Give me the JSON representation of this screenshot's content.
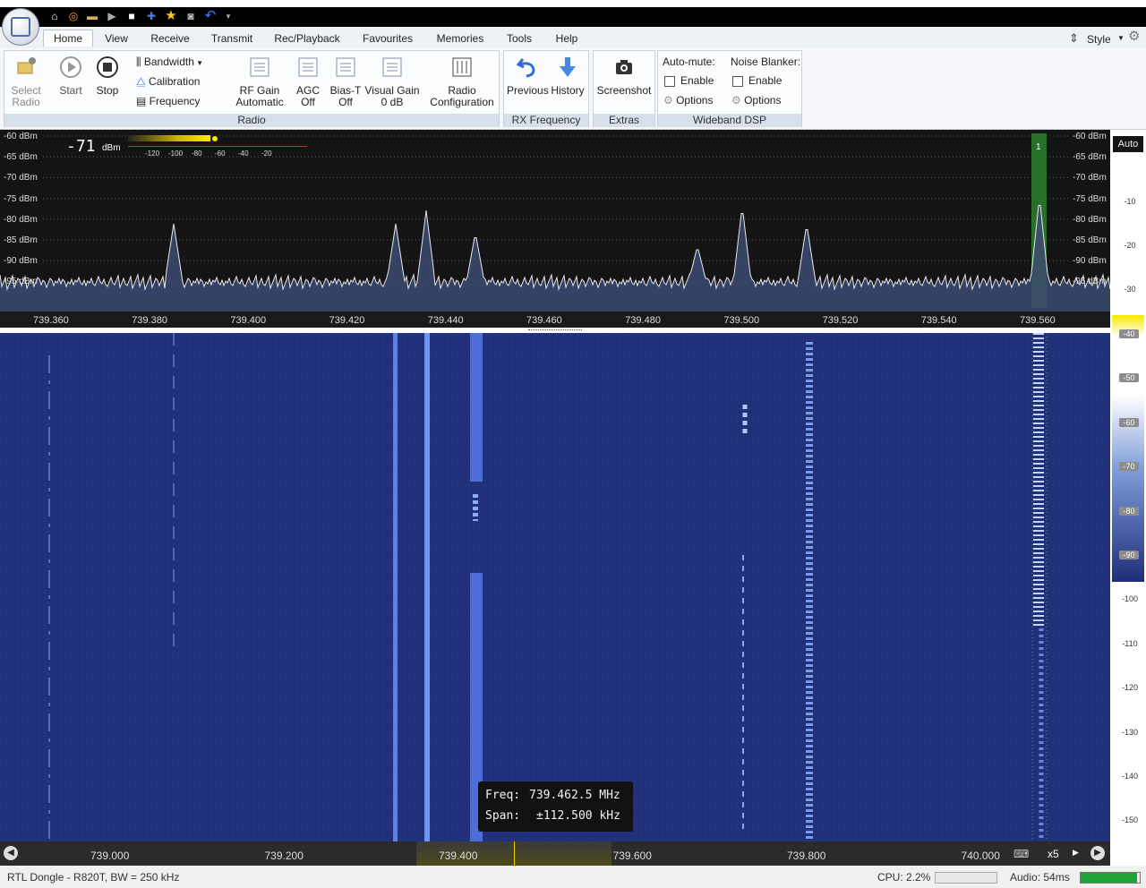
{
  "toolbar": {
    "style_label": "Style"
  },
  "tabs": [
    "Home",
    "View",
    "Receive",
    "Transmit",
    "Rec/Playback",
    "Favourites",
    "Memories",
    "Tools",
    "Help"
  ],
  "ribbon": {
    "select_radio": "Select\nRadio",
    "start": "Start",
    "stop": "Stop",
    "bandwidth": "Bandwidth",
    "calibration": "Calibration",
    "frequency": "Frequency",
    "rf_gain": "RF Gain",
    "rf_gain_val": "Automatic",
    "agc": "AGC",
    "agc_val": "Off",
    "biast": "Bias-T",
    "biast_val": "Off",
    "visual_gain": "Visual Gain",
    "visual_gain_val": "0 dB",
    "radio_config": "Radio\nConfiguration",
    "previous": "Previous",
    "history": "History",
    "screenshot": "Screenshot",
    "automute": "Auto-mute:",
    "noise_blanker": "Noise Blanker:",
    "enable": "Enable",
    "options": "Options",
    "group_radio": "Radio",
    "group_rx": "RX Frequency",
    "group_extras": "Extras",
    "group_wdsp": "Wideband DSP"
  },
  "spectrum": {
    "signal_value": "-71",
    "signal_unit": "dBm",
    "meter_ticks": [
      "-120",
      "-100",
      "-80",
      "-60",
      "-40",
      "-20"
    ],
    "left_db": [
      "-60 dBm",
      "-65 dBm",
      "-70 dBm",
      "-75 dBm",
      "-80 dBm",
      "-85 dBm",
      "-90 dBm",
      "-95 dBm"
    ],
    "right_db": [
      "-60 dBm",
      "-65 dBm",
      "-70 dBm",
      "-75 dBm",
      "-80 dBm",
      "-85 dBm",
      "-90 dBm",
      "-95 dBm"
    ],
    "right_scale_top": [
      "-10",
      "-20",
      "-30"
    ],
    "freq_ticks": [
      "739.360",
      "739.380",
      "739.400",
      "739.420",
      "739.440",
      "739.460",
      "739.480",
      "739.500",
      "739.520",
      "739.540",
      "739.560"
    ],
    "marker_label": "1"
  },
  "auto_label": "Auto",
  "waterfall_scale": [
    "-40",
    "-50",
    "-60",
    "-70",
    "-80",
    "-90",
    "-100",
    "-110",
    "-120",
    "-130",
    "-140",
    "-150"
  ],
  "tooltip": {
    "freq_label": "Freq:",
    "freq_value": "739.462.5 MHz",
    "span_label": "Span:",
    "span_value": "±112.500 kHz"
  },
  "overview": {
    "ticks": [
      "739.000",
      "739.200",
      "739.400",
      "739.600",
      "739.800",
      "740.000"
    ],
    "zoom": "x5"
  },
  "status": {
    "device": "RTL Dongle - R820T, BW = 250 kHz",
    "cpu": "CPU: 2.2%",
    "audio": "Audio: 54ms",
    "audio_level": 0.95
  }
}
